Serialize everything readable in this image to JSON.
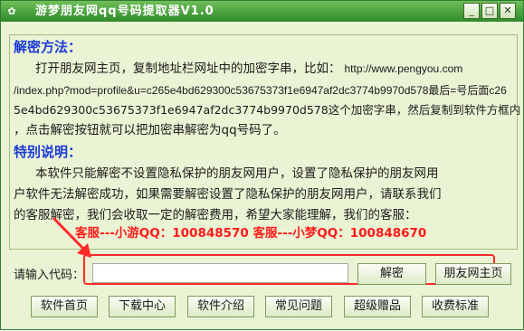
{
  "window": {
    "title": "游梦朋友网qq号码提取器V1.0"
  },
  "titlebar_buttons": [
    {
      "name": "minimize",
      "glyph": "_"
    },
    {
      "name": "maximize",
      "glyph": "□"
    },
    {
      "name": "close",
      "glyph": "✕"
    }
  ],
  "instructions": {
    "method_heading": "解密方法：",
    "method_lines": [
      "打开朋友网主页，复制地址栏网址中的加密字串，比如：",
      "http://www.pengyou.com",
      "/index.php?mod=profile&u=c265e4bd629300c53675373f1e6947af2dc3774b9970d578最后=号后面c26",
      "5e4bd629300c53675373f1e6947af2dc3774b9970d578这个加密字串，然后复制到软件方框内",
      "，点击解密按钮就可以把加密串解密为qq号码了。"
    ],
    "notice_heading": "特别说明：",
    "notice_lines": [
      "本软件只能解密不设置隐私保护的朋友网用户，设置了隐私保护的朋友网用",
      "户软件无法解密成功，如果需要解密设置了隐私保护的朋友网用户，请联系我们",
      "的客服解密，我们会收取一定的解密费用，希望大家能理解，我们的客服："
    ],
    "contact": "客服---小游QQ：100848570  客服---小梦QQ：100848670"
  },
  "code_input": {
    "label": "请输入代码：",
    "value": ""
  },
  "actions": {
    "decrypt": "解密",
    "homepage": "朋友网主页"
  },
  "nav_buttons": [
    "软件首页",
    "下载中心",
    "软件介绍",
    "常见问题",
    "超级赠品",
    "收费标准"
  ],
  "colors": {
    "heading": "#1c3bd6",
    "contact": "#ff1a1a",
    "highlight": "#ff2a2a",
    "panel": "#eaf3d4",
    "titlebar": "#2f8a2a"
  }
}
